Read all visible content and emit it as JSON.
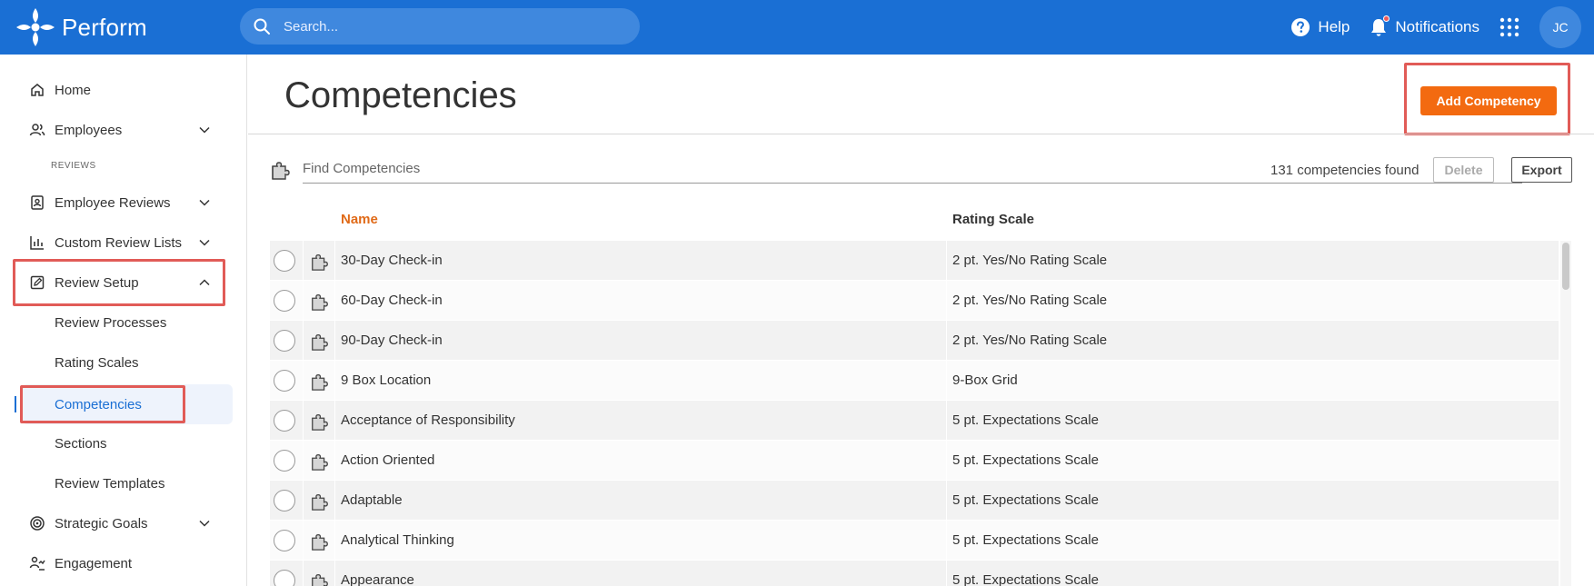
{
  "header": {
    "brand": "Perform",
    "search_placeholder": "Search...",
    "help_label": "Help",
    "notifications_label": "Notifications",
    "avatar_initials": "JC"
  },
  "sidebar": {
    "home": "Home",
    "employees": "Employees",
    "reviews_section": "REVIEWS",
    "employee_reviews": "Employee Reviews",
    "custom_review_lists": "Custom Review Lists",
    "review_setup": "Review Setup",
    "sub_items": [
      "Review Processes",
      "Rating Scales",
      "Competencies",
      "Sections",
      "Review Templates"
    ],
    "strategic_goals": "Strategic Goals",
    "engagement": "Engagement"
  },
  "main": {
    "title": "Competencies",
    "add_button": "Add Competency",
    "find_placeholder": "Find Competencies",
    "count_text": "131 competencies found",
    "delete_label": "Delete",
    "export_label": "Export",
    "columns": {
      "name": "Name",
      "rating_scale": "Rating Scale"
    },
    "rows": [
      {
        "name": "30-Day Check-in",
        "scale": "2 pt. Yes/No Rating Scale"
      },
      {
        "name": "60-Day Check-in",
        "scale": "2 pt. Yes/No Rating Scale"
      },
      {
        "name": "90-Day Check-in",
        "scale": "2 pt. Yes/No Rating Scale"
      },
      {
        "name": "9 Box Location",
        "scale": "9-Box Grid"
      },
      {
        "name": "Acceptance of Responsibility",
        "scale": "5 pt. Expectations Scale"
      },
      {
        "name": "Action Oriented",
        "scale": "5 pt. Expectations Scale"
      },
      {
        "name": "Adaptable",
        "scale": "5 pt. Expectations Scale"
      },
      {
        "name": "Analytical Thinking",
        "scale": "5 pt. Expectations Scale"
      },
      {
        "name": "Appearance",
        "scale": "5 pt. Expectations Scale"
      }
    ]
  },
  "colors": {
    "header_blue": "#1a6fd4",
    "accent_orange": "#f36a10",
    "highlight_red": "#e15b57",
    "sort_header_orange": "#e06a18"
  }
}
